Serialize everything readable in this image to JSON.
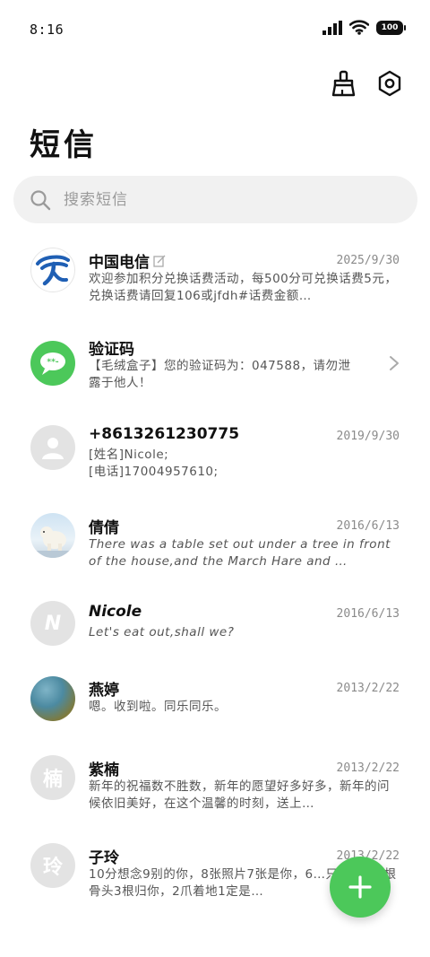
{
  "status": {
    "time": "8:16",
    "battery": "100"
  },
  "header": {
    "title": "短信"
  },
  "search": {
    "placeholder": "搜索短信"
  },
  "messages": [
    {
      "name": "中国电信",
      "date": "2025/9/30",
      "preview": "欢迎参加积分兑换话费活动，每500分可兑换话费5元，兑换话费请回复106或jfdh#话费金额…",
      "avatar": "telecom-logo"
    },
    {
      "name": "验证码",
      "date": "",
      "preview": "【毛绒盒子】您的验证码为：047588，请勿泄露于他人！",
      "avatar": "message-bubble-icon"
    },
    {
      "name": "+8613261230775",
      "date": "2019/9/30",
      "preview": "[姓名]Nicole;\n[电话]17004957610;",
      "avatar": "person-icon"
    },
    {
      "name": "倩倩",
      "date": "2016/6/13",
      "preview": "There was a table set out under a tree in front of the house,and the March Hare and …",
      "avatar": "polar-bear-photo"
    },
    {
      "name": "Nicole",
      "date": "2016/6/13",
      "preview": "Let's eat out,shall we?",
      "avatar_letter": "N"
    },
    {
      "name": "燕婷",
      "date": "2013/2/22",
      "preview": "嗯。收到啦。同乐同乐。",
      "avatar": "landscape-photo"
    },
    {
      "name": "紫楠",
      "date": "2013/2/22",
      "preview": "新年的祝福数不胜数，新年的愿望好多好多，新年的问候依旧美好，在这个温馨的时刻，送上…",
      "avatar_letter": "楠"
    },
    {
      "name": "子玲",
      "date": "2013/2/22",
      "preview": "10分想念9别的你，8张照片7张是你，6…只像你，4根骨头3根归你，2爪着地1定是…",
      "avatar_letter": "玲"
    }
  ],
  "colors": {
    "accent": "#4cc85a",
    "telecom_blue": "#1f5fb4"
  }
}
